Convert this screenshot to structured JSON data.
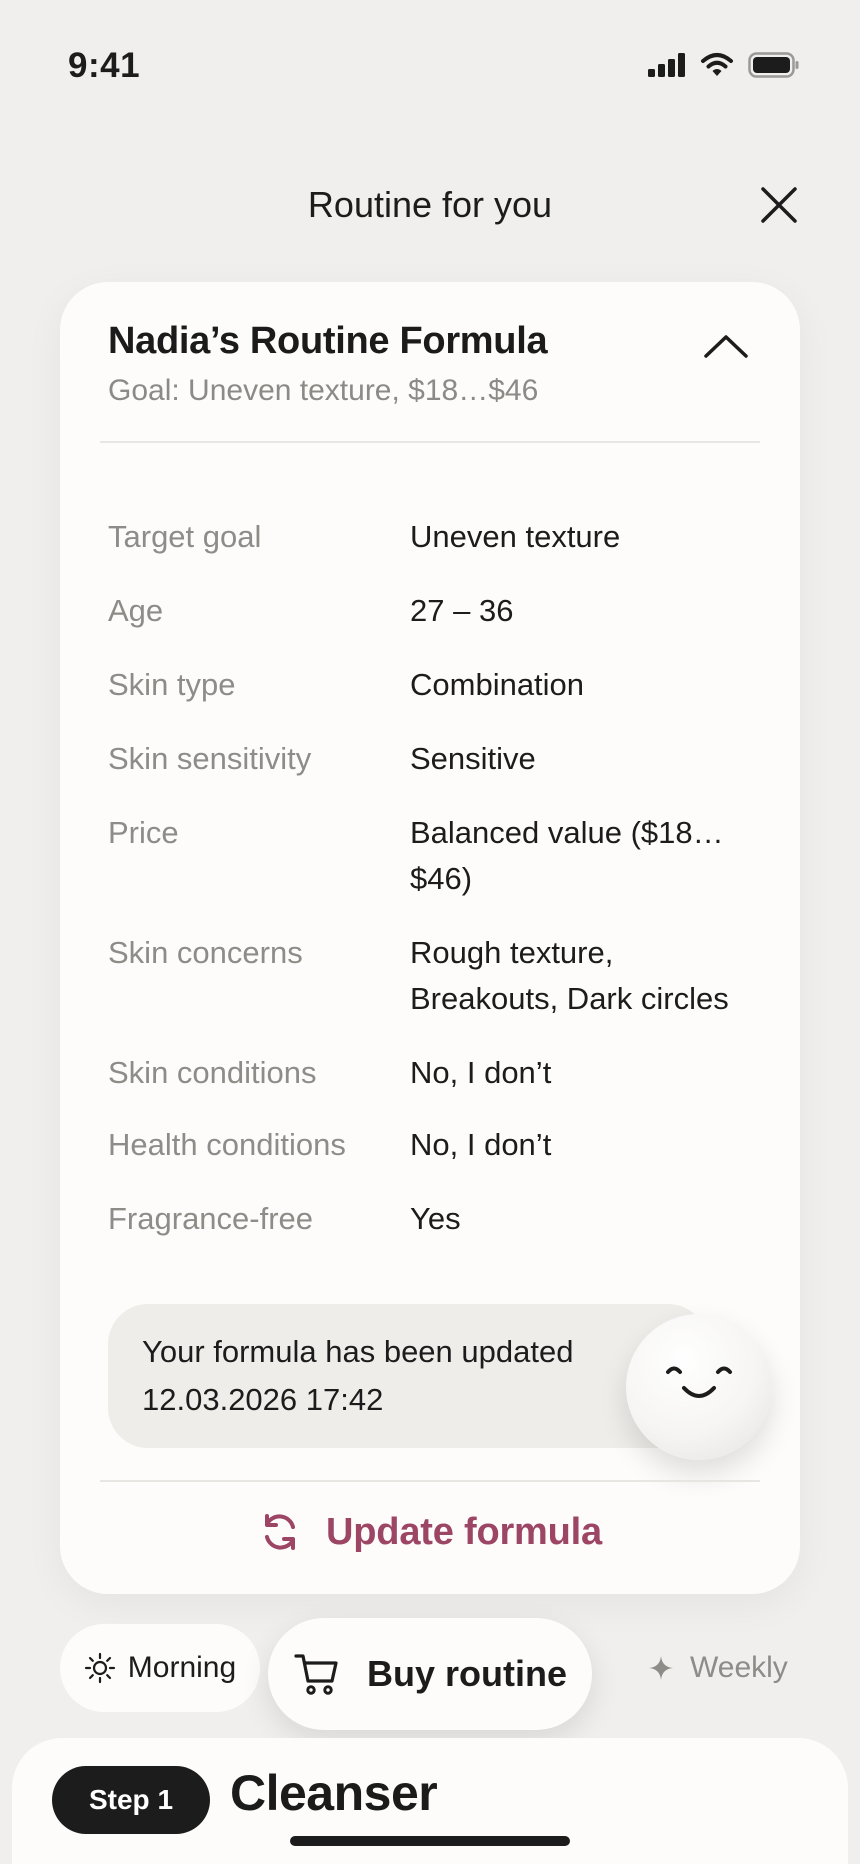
{
  "status_bar": {
    "time": "9:41"
  },
  "header": {
    "title": "Routine for you",
    "close_icon": "close-icon"
  },
  "card": {
    "title": "Nadia’s Routine Formula",
    "goal": "Goal: Uneven texture, $18…$46",
    "rows": [
      {
        "label": "Target goal",
        "value": "Uneven texture"
      },
      {
        "label": "Age",
        "value": "27 – 36"
      },
      {
        "label": "Skin type",
        "value": "Combination"
      },
      {
        "label": "Skin sensitivity",
        "value": "Sensitive"
      },
      {
        "label": "Price",
        "value": "Balanced value ($18… $46)"
      },
      {
        "label": "Skin concerns",
        "value": "Rough texture, Breakouts, Dark circles"
      },
      {
        "label": "Skin conditions",
        "value": "No, I don’t"
      },
      {
        "label": "Health conditions",
        "value": "No, I don’t"
      },
      {
        "label": "Fragrance-free",
        "value": "Yes"
      }
    ],
    "notice": {
      "line1": "Your formula has been updated",
      "line2": "12.03.2026 17:42"
    },
    "update_label": "Update formula"
  },
  "bottom_bar": {
    "morning_label": "Morning",
    "buy_label": "Buy routine",
    "weekly_label": "Weekly"
  },
  "sheet": {
    "step_label": "Step 1",
    "step_title": "Cleanser"
  },
  "colors": {
    "accent": "#9c4565",
    "background": "#f0efed",
    "card": "#fdfcfa",
    "muted_text": "#8e8c88"
  }
}
